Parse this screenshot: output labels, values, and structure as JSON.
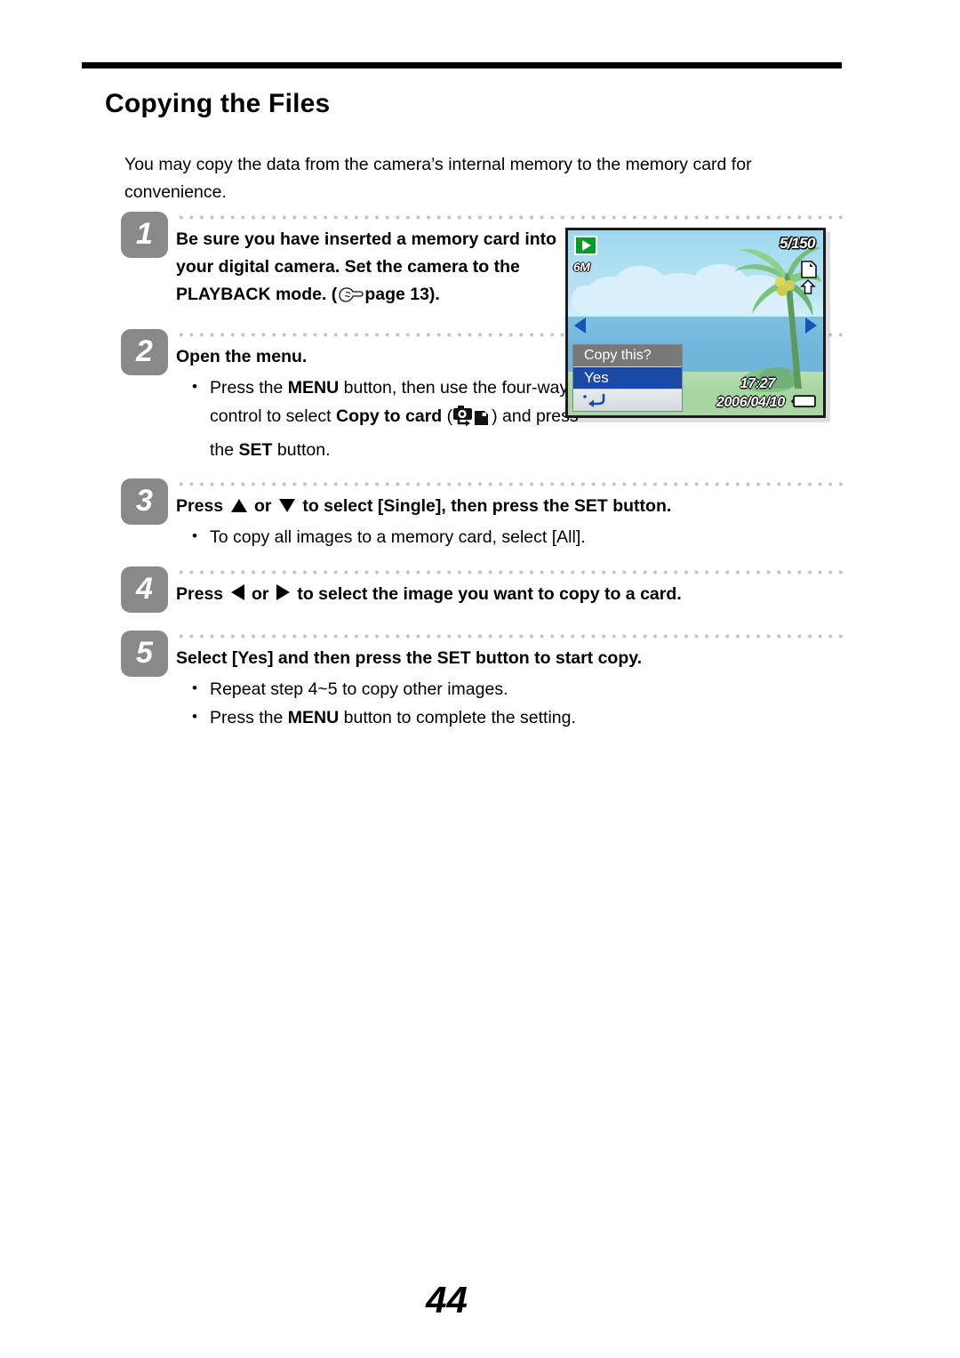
{
  "document": {
    "title": "Copying the Files",
    "intro": "You may copy the data from the camera’s internal memory to the memory card for convenience.",
    "page_number": "44"
  },
  "steps": [
    {
      "number": "1",
      "text_part1": "Be sure you have inserted a memory card into your digital camera. Set the camera to the PLAYBACK mode. (",
      "hand_icon": "pointing-hand-icon",
      "text_part2": "page 13).",
      "bullets": []
    },
    {
      "number": "2",
      "text": "Open the menu.",
      "bullets": [
        {
          "part1": "Press the ",
          "bold1": "MENU",
          "part2": " button, then use the four-way control to select ",
          "bold2": "Copy to card",
          "part3": " (",
          "icon": "copy-to-card-icon",
          "part4": ") and press the ",
          "bold3": "SET",
          "part5": " button."
        }
      ]
    },
    {
      "number": "3",
      "text_before_up": "Press",
      "up_icon": "arrow-up-icon",
      "text_or": "or",
      "down_icon": "arrow-down-icon",
      "text_after": "to select [Single], then press the SET button.",
      "bullets": [
        {
          "text": "To copy all images to a memory card, select [All]."
        }
      ]
    },
    {
      "number": "4",
      "text_before_left": "Press",
      "left_icon": "arrow-left-icon",
      "text_or": "or",
      "right_icon": "arrow-right-icon",
      "text_after": "to select the image you want to copy to a card.",
      "bullets": []
    },
    {
      "number": "5",
      "text": "Select [Yes] and then press the SET button to start copy.",
      "bullets": [
        {
          "text": "Repeat step 4~5 to copy other images."
        },
        {
          "part1": "Press the ",
          "bold1": "MENU",
          "part2": " button to complete the setting."
        }
      ]
    }
  ],
  "camera_lcd": {
    "playback_icon": "playback-mode-icon",
    "resolution": "6M",
    "frame_counter": "5/150",
    "memory_card_icon": "memory-card-copy-icon",
    "prev_icon": "nav-arrow-left-icon",
    "next_icon": "nav-arrow-right-icon",
    "time": "17:27",
    "date": "2006/04/10",
    "battery_icon": "battery-icon",
    "dialog": {
      "title": "Copy this?",
      "selected_option": "Yes",
      "back_icon": "return-arrow-icon"
    },
    "colors": {
      "playback_green": "#029a29",
      "selection_blue": "#1a49a6",
      "dialog_gray": "#787878",
      "nav_arrow_blue": "#1155b8",
      "sky": "#b9e4f4",
      "sea": "#7ec0e0",
      "land": "#a9d7a4"
    }
  }
}
